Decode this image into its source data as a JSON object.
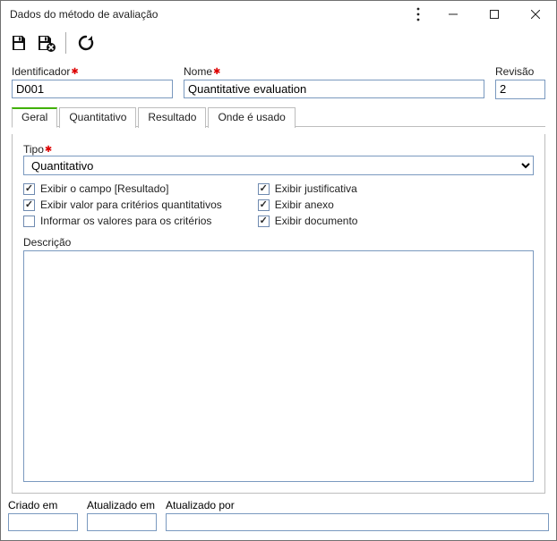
{
  "window": {
    "title": "Dados do método de avaliação"
  },
  "toolbar": {
    "save_title": "Salvar",
    "save_close_title": "Salvar e fechar",
    "refresh_title": "Atualizar"
  },
  "fields": {
    "identificador": {
      "label": "Identificador",
      "value": "D001"
    },
    "nome": {
      "label": "Nome",
      "value": "Quantitative evaluation"
    },
    "revisao": {
      "label": "Revisão",
      "value": "2"
    }
  },
  "tabs": {
    "geral": "Geral",
    "quantitativo": "Quantitativo",
    "resultado": "Resultado",
    "onde": "Onde é usado"
  },
  "geral": {
    "tipo_label": "Tipo",
    "tipo_value": "Quantitativo",
    "checks": {
      "exibir_resultado": "Exibir o campo [Resultado]",
      "exibir_valor_crit": "Exibir valor para critérios quantitativos",
      "informar_valores": "Informar os valores para os critérios",
      "exibir_justificativa": "Exibir justificativa",
      "exibir_anexo": "Exibir anexo",
      "exibir_documento": "Exibir documento"
    },
    "descricao_label": "Descrição",
    "descricao_value": ""
  },
  "footer": {
    "criado_em_label": "Criado em",
    "criado_em_value": "",
    "atualizado_em_label": "Atualizado em",
    "atualizado_em_value": "",
    "atualizado_por_label": "Atualizado por",
    "atualizado_por_value": ""
  }
}
